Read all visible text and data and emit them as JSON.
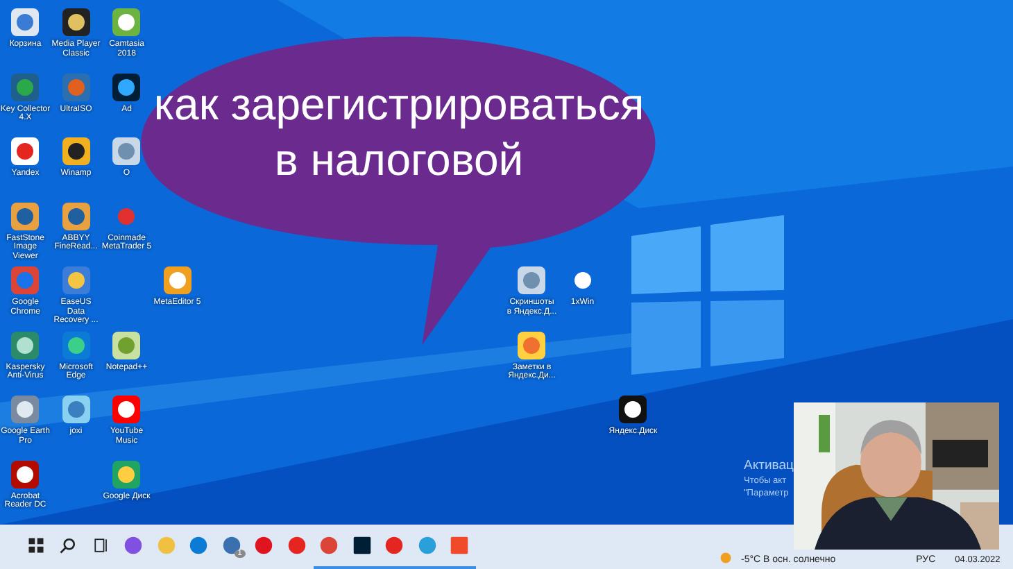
{
  "desktop_icons": [
    {
      "kind": "recycle",
      "label": "Корзина"
    },
    {
      "kind": "key",
      "label": "Key Collector 4.X"
    },
    {
      "kind": "yandex",
      "label": "Yandex"
    },
    {
      "kind": "eye",
      "label": "FastStone Image Viewer"
    },
    {
      "kind": "chrome",
      "label": "Google Chrome"
    },
    {
      "kind": "shield",
      "label": "Kaspersky Anti-Virus"
    },
    {
      "kind": "globe",
      "label": "Google Earth Pro"
    },
    {
      "kind": "pdf",
      "label": "Acrobat Reader DC"
    },
    {
      "kind": "film",
      "label": "Media Player Classic"
    },
    {
      "kind": "disc",
      "label": "UltraISO"
    },
    {
      "kind": "bolt",
      "label": "Winamp"
    },
    {
      "kind": "eye",
      "label": "ABBYY FineRead..."
    },
    {
      "kind": "case",
      "label": "EaseUS Data Recovery ..."
    },
    {
      "kind": "edge",
      "label": "Microsoft Edge"
    },
    {
      "kind": "bird",
      "label": "joxi"
    },
    {
      "kind": "green",
      "label": "Camtasia 2018"
    },
    {
      "kind": "ps",
      "label": "Ad"
    },
    {
      "kind": "blank",
      "label": "O"
    },
    {
      "kind": "w",
      "label": "Coinmade MetaTrader 5"
    },
    {
      "kind": "note",
      "label": "Notepad++"
    },
    {
      "kind": "play",
      "label": "YouTube Music"
    },
    {
      "kind": "drive",
      "label": "Google Диск"
    },
    {
      "kind": "meta",
      "label": "MetaEditor 5"
    },
    {
      "kind": "blank",
      "label": "Скриншоты в Яндекс.Д..."
    },
    {
      "kind": "xwin",
      "label": "1xWin"
    },
    {
      "kind": "notes",
      "label": "Заметки в Яндекс.Ди..."
    },
    {
      "kind": "cloud",
      "label": "Яндекс.Диск"
    }
  ],
  "bubble": {
    "lines": [
      "как зарегистрироваться",
      "в налоговой"
    ]
  },
  "activation": [
    "Активац",
    "Чтобы акт",
    "\"Параметр"
  ],
  "taskbar": {
    "apps": [
      {
        "kind": "start",
        "running": false
      },
      {
        "kind": "search",
        "running": false
      },
      {
        "kind": "taskview",
        "running": false
      },
      {
        "kind": "alice",
        "running": false
      },
      {
        "kind": "folder",
        "running": false
      },
      {
        "kind": "edge",
        "running": false
      },
      {
        "kind": "mail",
        "running": false,
        "badge": "1"
      },
      {
        "kind": "opera",
        "running": false
      },
      {
        "kind": "yandex",
        "running": false
      },
      {
        "kind": "chrome",
        "running": true
      },
      {
        "kind": "ps",
        "running": true
      },
      {
        "kind": "yandex",
        "running": true
      },
      {
        "kind": "telegram",
        "running": true
      },
      {
        "kind": "camtasia",
        "running": true
      }
    ],
    "weather": "-5°C  В осн. солнечно",
    "language": "РУС",
    "date": "04.03.2022"
  }
}
